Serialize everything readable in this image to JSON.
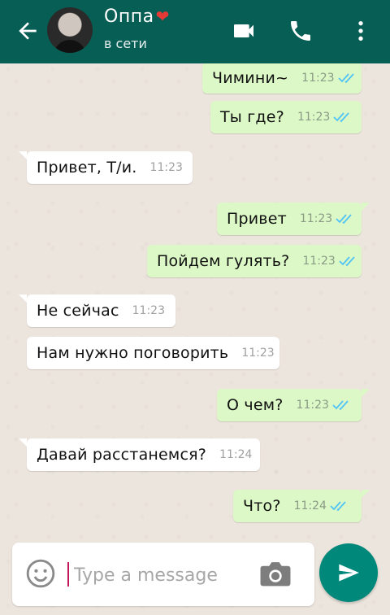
{
  "header": {
    "contact_name": "Оппа",
    "heart": "❤",
    "status": "в сети"
  },
  "messages": [
    {
      "dir": "out",
      "text": "Чимини~",
      "time": "11:23",
      "read": true
    },
    {
      "dir": "out",
      "text": "Ты где?",
      "time": "11:23",
      "read": true
    },
    {
      "dir": "in",
      "text": "Привет, Т/и.",
      "time": "11:23"
    },
    {
      "dir": "out",
      "text": "Привет",
      "time": "11:23",
      "read": true
    },
    {
      "dir": "out",
      "text": "Пойдем гулять?",
      "time": "11:23",
      "read": true
    },
    {
      "dir": "in",
      "text": "Не сейчас",
      "time": "11:23"
    },
    {
      "dir": "in",
      "text": "Нам нужно поговорить",
      "time": "11:23"
    },
    {
      "dir": "out",
      "text": "О чем?",
      "time": "11:23",
      "read": true
    },
    {
      "dir": "in",
      "text": "Давай расстанемся?",
      "time": "11:24"
    },
    {
      "dir": "out",
      "text": "Что?",
      "time": "11:24",
      "read": true
    }
  ],
  "composer": {
    "placeholder": "Type a message",
    "value": ""
  },
  "icons": {
    "back": "arrow-back-icon",
    "video": "videocam-icon",
    "call": "phone-icon",
    "more": "more-vert-icon",
    "emoji": "emoji-icon",
    "camera": "camera-icon",
    "send": "send-icon",
    "read_receipt": "double-check-icon"
  },
  "colors": {
    "header": "#075e54",
    "outgoing_bubble": "#dcf8c6",
    "incoming_bubble": "#ffffff",
    "read_ticks": "#4fc3f7",
    "send_button": "#00897b",
    "chat_background": "#ece5dd"
  }
}
